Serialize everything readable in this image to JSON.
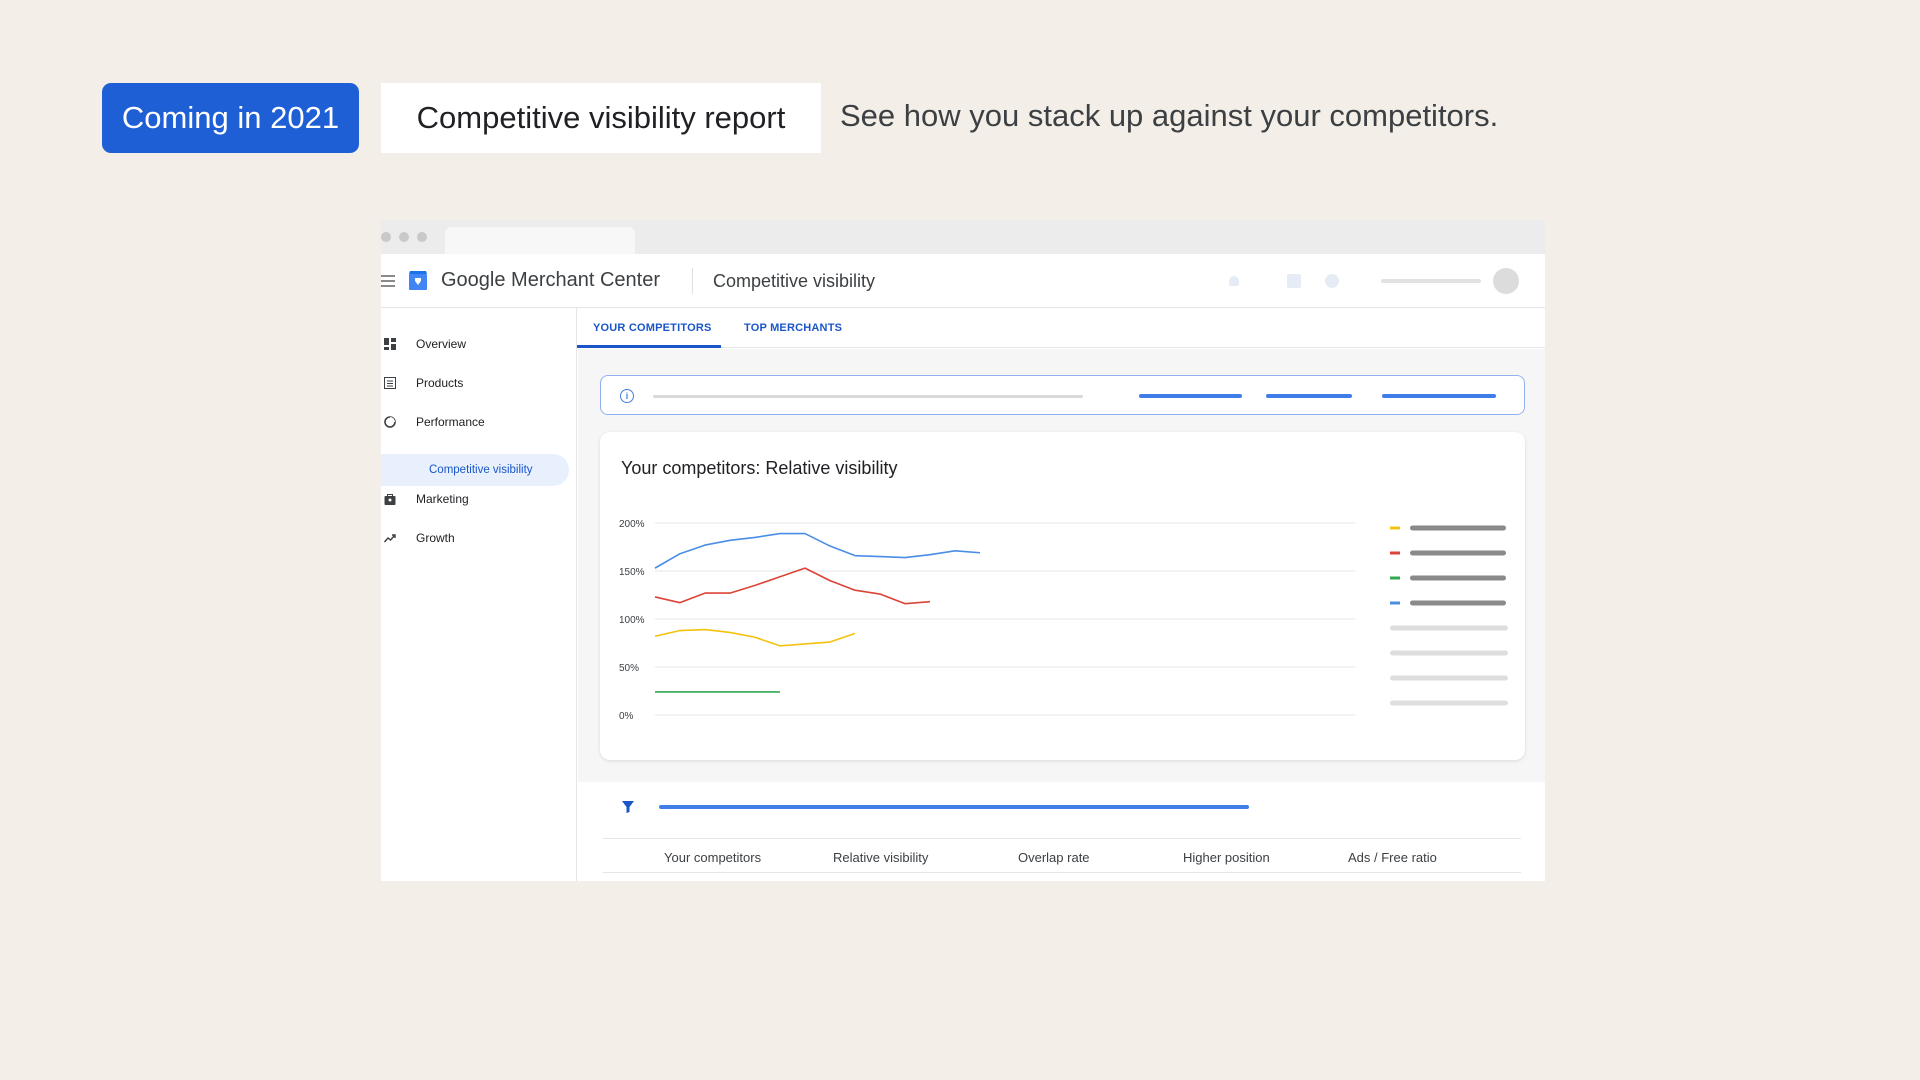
{
  "header": {
    "badge": "Coming in 2021",
    "report_title": "Competitive visibility report",
    "tagline": "See how you stack up against your competitors."
  },
  "app": {
    "name": "Google Merchant Center",
    "page_title": "Competitive visibility"
  },
  "sidebar": {
    "items": [
      {
        "label": "Overview",
        "icon": "dashboard-icon"
      },
      {
        "label": "Products",
        "icon": "products-icon"
      },
      {
        "label": "Performance",
        "icon": "performance-icon"
      },
      {
        "label": "Marketing",
        "icon": "marketing-icon"
      },
      {
        "label": "Growth",
        "icon": "trending-up-icon"
      }
    ],
    "sub_item": "Competitive visibility"
  },
  "tabs": [
    {
      "label": "YOUR COMPETITORS",
      "active": true
    },
    {
      "label": "TOP MERCHANTS",
      "active": false
    }
  ],
  "card_title": "Your competitors: Relative visibility",
  "table": {
    "headers": [
      "Your competitors",
      "Relative visibility",
      "Overlap rate",
      "Higher position",
      "Ads / Free ratio"
    ]
  },
  "colors": {
    "accent": "#1f5fd6",
    "blue": "#4a8de6",
    "red": "#db4437",
    "yellow": "#f4c20d",
    "green": "#34a853"
  },
  "chart_data": {
    "type": "line",
    "title": "",
    "ytick_labels": [
      "200%",
      "150%",
      "100%",
      "50%",
      "0%"
    ],
    "ylim": [
      0,
      200
    ],
    "x": [
      0,
      1,
      2,
      3,
      4,
      5,
      6,
      7,
      8,
      9,
      10,
      11,
      12,
      13
    ],
    "series": [
      {
        "color": "#4a8de6",
        "values": [
          153,
          168,
          177,
          182,
          185,
          189,
          189,
          176,
          166,
          165,
          164,
          167,
          171,
          169
        ]
      },
      {
        "color": "#db4437",
        "values": [
          123,
          117,
          127,
          127,
          135,
          144,
          153,
          140,
          130,
          126,
          116,
          118
        ]
      },
      {
        "color": "#f4c20d",
        "values": [
          82,
          88,
          89,
          86,
          81,
          72,
          74,
          76,
          85
        ]
      },
      {
        "color": "#34a853",
        "values": [
          24,
          24,
          24,
          24,
          24,
          24
        ]
      }
    ],
    "legend_colors": [
      "#f4c20d",
      "#db4437",
      "#34a853",
      "#4a8de6"
    ],
    "grid": true,
    "legend_position": "right"
  }
}
